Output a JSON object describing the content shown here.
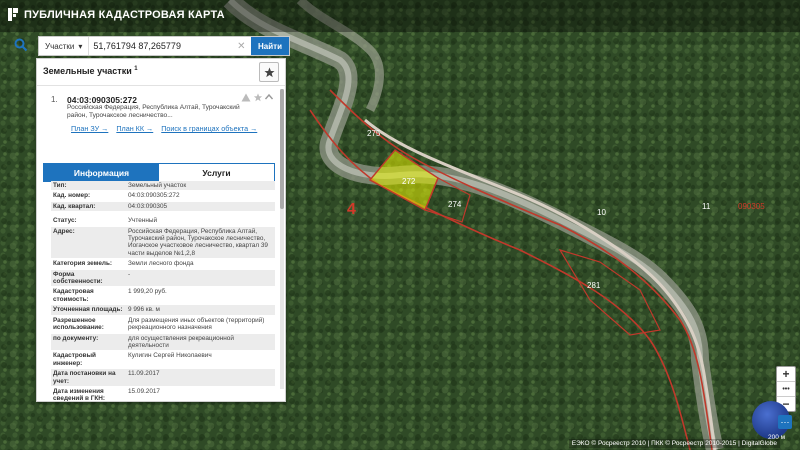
{
  "app": {
    "title": "ПУБЛИЧНАЯ КАДАСТРОВАЯ КАРТА"
  },
  "search": {
    "type": "Участки",
    "query": "51,761794 87,265779",
    "button": "Найти"
  },
  "panel": {
    "title": "Земельные участки",
    "count": "1",
    "result": {
      "index": "1.",
      "cad_number": "04:03:090305:272",
      "address": "Российская Федерация, Республика Алтай, Турочакский район, Турочакское лесничество...",
      "links": [
        "План ЗУ →",
        "План КК →",
        "Поиск в границах объекта →"
      ]
    },
    "tabs": [
      "Информация",
      "Услуги"
    ],
    "rows": [
      {
        "key": "Тип:",
        "value": "Земельный участок"
      },
      {
        "key": "Кад. номер:",
        "value": "04:03:090305:272",
        "link": true
      },
      {
        "key": "Кад. квартал:",
        "value": "04:03:090305",
        "link": true
      },
      {
        "key": "Статус:",
        "value": "Учтенный"
      },
      {
        "key": "Адрес:",
        "value": "Российская Федерация, Республика Алтай, Турочакский район, Турочакское лесничество, Иогачское участковое лесничество, квартал 39 части выделов №1,2,8"
      },
      {
        "key": "Категория земель:",
        "value": "Земли лесного фонда"
      },
      {
        "key": "Форма собственности:",
        "value": "-"
      },
      {
        "key": "Кадастровая стоимость:",
        "value": "1 999,20 руб."
      },
      {
        "key": "Уточненная площадь:",
        "value": "9 996 кв. м"
      },
      {
        "key": "Разрешенное использование:",
        "value": "Для размещения иных объектов (территорий) рекреационного назначения"
      },
      {
        "key": "по документу:",
        "value": "для осуществления рекреационной деятельности"
      },
      {
        "key": "Кадастровый инженер:",
        "value": "Кулигин Сергей Николаевич"
      },
      {
        "key": "Дата постановки на учет:",
        "value": "11.09.2017"
      },
      {
        "key": "Дата изменения сведений в ГКН:",
        "value": "15.09.2017"
      }
    ]
  },
  "map": {
    "labels": [
      "275",
      "272",
      "274",
      "4",
      "10",
      "11",
      "090305",
      "281"
    ],
    "attribution": "ЕЭКО © Росреестр 2010 | ПКК © Росреестр 2010-2015 | DigitalGlobe",
    "scale": "200 м",
    "zoom_in": "+",
    "zoom_out": "−"
  },
  "colors": {
    "accent": "#1e73be",
    "parcel": "#c0392b",
    "highlight": "#e6f000"
  }
}
